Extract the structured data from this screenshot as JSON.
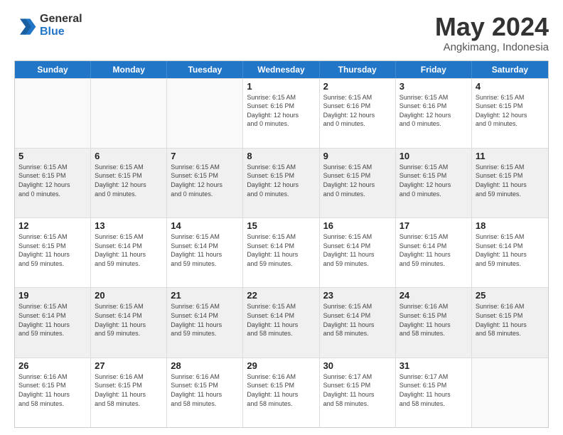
{
  "logo": {
    "general": "General",
    "blue": "Blue"
  },
  "header": {
    "month": "May 2024",
    "location": "Angkimang, Indonesia"
  },
  "weekdays": [
    "Sunday",
    "Monday",
    "Tuesday",
    "Wednesday",
    "Thursday",
    "Friday",
    "Saturday"
  ],
  "rows": [
    [
      {
        "day": "",
        "lines": []
      },
      {
        "day": "",
        "lines": []
      },
      {
        "day": "",
        "lines": []
      },
      {
        "day": "1",
        "lines": [
          "Sunrise: 6:15 AM",
          "Sunset: 6:16 PM",
          "Daylight: 12 hours",
          "and 0 minutes."
        ]
      },
      {
        "day": "2",
        "lines": [
          "Sunrise: 6:15 AM",
          "Sunset: 6:16 PM",
          "Daylight: 12 hours",
          "and 0 minutes."
        ]
      },
      {
        "day": "3",
        "lines": [
          "Sunrise: 6:15 AM",
          "Sunset: 6:16 PM",
          "Daylight: 12 hours",
          "and 0 minutes."
        ]
      },
      {
        "day": "4",
        "lines": [
          "Sunrise: 6:15 AM",
          "Sunset: 6:15 PM",
          "Daylight: 12 hours",
          "and 0 minutes."
        ]
      }
    ],
    [
      {
        "day": "5",
        "lines": [
          "Sunrise: 6:15 AM",
          "Sunset: 6:15 PM",
          "Daylight: 12 hours",
          "and 0 minutes."
        ]
      },
      {
        "day": "6",
        "lines": [
          "Sunrise: 6:15 AM",
          "Sunset: 6:15 PM",
          "Daylight: 12 hours",
          "and 0 minutes."
        ]
      },
      {
        "day": "7",
        "lines": [
          "Sunrise: 6:15 AM",
          "Sunset: 6:15 PM",
          "Daylight: 12 hours",
          "and 0 minutes."
        ]
      },
      {
        "day": "8",
        "lines": [
          "Sunrise: 6:15 AM",
          "Sunset: 6:15 PM",
          "Daylight: 12 hours",
          "and 0 minutes."
        ]
      },
      {
        "day": "9",
        "lines": [
          "Sunrise: 6:15 AM",
          "Sunset: 6:15 PM",
          "Daylight: 12 hours",
          "and 0 minutes."
        ]
      },
      {
        "day": "10",
        "lines": [
          "Sunrise: 6:15 AM",
          "Sunset: 6:15 PM",
          "Daylight: 12 hours",
          "and 0 minutes."
        ]
      },
      {
        "day": "11",
        "lines": [
          "Sunrise: 6:15 AM",
          "Sunset: 6:15 PM",
          "Daylight: 11 hours",
          "and 59 minutes."
        ]
      }
    ],
    [
      {
        "day": "12",
        "lines": [
          "Sunrise: 6:15 AM",
          "Sunset: 6:15 PM",
          "Daylight: 11 hours",
          "and 59 minutes."
        ]
      },
      {
        "day": "13",
        "lines": [
          "Sunrise: 6:15 AM",
          "Sunset: 6:14 PM",
          "Daylight: 11 hours",
          "and 59 minutes."
        ]
      },
      {
        "day": "14",
        "lines": [
          "Sunrise: 6:15 AM",
          "Sunset: 6:14 PM",
          "Daylight: 11 hours",
          "and 59 minutes."
        ]
      },
      {
        "day": "15",
        "lines": [
          "Sunrise: 6:15 AM",
          "Sunset: 6:14 PM",
          "Daylight: 11 hours",
          "and 59 minutes."
        ]
      },
      {
        "day": "16",
        "lines": [
          "Sunrise: 6:15 AM",
          "Sunset: 6:14 PM",
          "Daylight: 11 hours",
          "and 59 minutes."
        ]
      },
      {
        "day": "17",
        "lines": [
          "Sunrise: 6:15 AM",
          "Sunset: 6:14 PM",
          "Daylight: 11 hours",
          "and 59 minutes."
        ]
      },
      {
        "day": "18",
        "lines": [
          "Sunrise: 6:15 AM",
          "Sunset: 6:14 PM",
          "Daylight: 11 hours",
          "and 59 minutes."
        ]
      }
    ],
    [
      {
        "day": "19",
        "lines": [
          "Sunrise: 6:15 AM",
          "Sunset: 6:14 PM",
          "Daylight: 11 hours",
          "and 59 minutes."
        ]
      },
      {
        "day": "20",
        "lines": [
          "Sunrise: 6:15 AM",
          "Sunset: 6:14 PM",
          "Daylight: 11 hours",
          "and 59 minutes."
        ]
      },
      {
        "day": "21",
        "lines": [
          "Sunrise: 6:15 AM",
          "Sunset: 6:14 PM",
          "Daylight: 11 hours",
          "and 59 minutes."
        ]
      },
      {
        "day": "22",
        "lines": [
          "Sunrise: 6:15 AM",
          "Sunset: 6:14 PM",
          "Daylight: 11 hours",
          "and 58 minutes."
        ]
      },
      {
        "day": "23",
        "lines": [
          "Sunrise: 6:15 AM",
          "Sunset: 6:14 PM",
          "Daylight: 11 hours",
          "and 58 minutes."
        ]
      },
      {
        "day": "24",
        "lines": [
          "Sunrise: 6:16 AM",
          "Sunset: 6:15 PM",
          "Daylight: 11 hours",
          "and 58 minutes."
        ]
      },
      {
        "day": "25",
        "lines": [
          "Sunrise: 6:16 AM",
          "Sunset: 6:15 PM",
          "Daylight: 11 hours",
          "and 58 minutes."
        ]
      }
    ],
    [
      {
        "day": "26",
        "lines": [
          "Sunrise: 6:16 AM",
          "Sunset: 6:15 PM",
          "Daylight: 11 hours",
          "and 58 minutes."
        ]
      },
      {
        "day": "27",
        "lines": [
          "Sunrise: 6:16 AM",
          "Sunset: 6:15 PM",
          "Daylight: 11 hours",
          "and 58 minutes."
        ]
      },
      {
        "day": "28",
        "lines": [
          "Sunrise: 6:16 AM",
          "Sunset: 6:15 PM",
          "Daylight: 11 hours",
          "and 58 minutes."
        ]
      },
      {
        "day": "29",
        "lines": [
          "Sunrise: 6:16 AM",
          "Sunset: 6:15 PM",
          "Daylight: 11 hours",
          "and 58 minutes."
        ]
      },
      {
        "day": "30",
        "lines": [
          "Sunrise: 6:17 AM",
          "Sunset: 6:15 PM",
          "Daylight: 11 hours",
          "and 58 minutes."
        ]
      },
      {
        "day": "31",
        "lines": [
          "Sunrise: 6:17 AM",
          "Sunset: 6:15 PM",
          "Daylight: 11 hours",
          "and 58 minutes."
        ]
      },
      {
        "day": "",
        "lines": []
      }
    ]
  ]
}
